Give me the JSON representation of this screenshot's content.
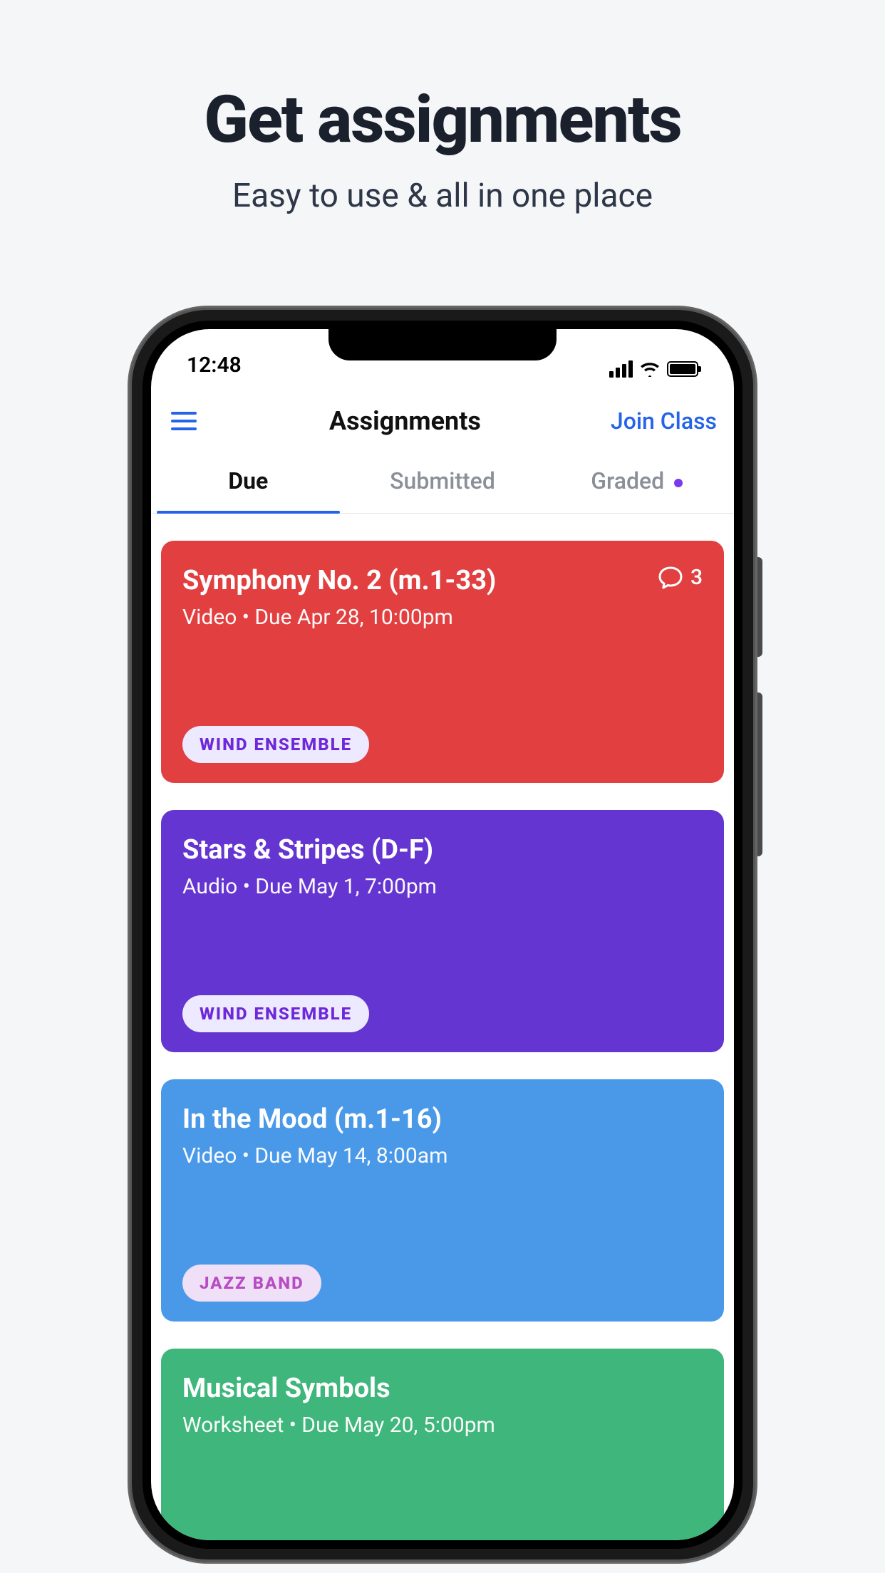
{
  "promo": {
    "title": "Get assignments",
    "subtitle": "Easy to use & all in one place"
  },
  "status": {
    "time": "12:48"
  },
  "nav": {
    "title": "Assignments",
    "join": "Join Class"
  },
  "tabs": {
    "due": "Due",
    "submitted": "Submitted",
    "graded": "Graded",
    "graded_has_dot": true,
    "active": "due"
  },
  "cards": [
    {
      "title": "Symphony No. 2 (m.1-33)",
      "sub": "Video • Due Apr 28, 10:00pm",
      "chip": "WIND ENSEMBLE",
      "comments": "3",
      "color": "red"
    },
    {
      "title": "Stars & Stripes (D-F)",
      "sub": "Audio • Due May 1, 7:00pm",
      "chip": "WIND ENSEMBLE",
      "color": "purple"
    },
    {
      "title": "In the Mood (m.1-16)",
      "sub": "Video • Due May 14, 8:00am",
      "chip": "JAZZ BAND",
      "chipStyle": "blue",
      "color": "blue"
    },
    {
      "title": "Musical Symbols",
      "sub": "Worksheet • Due May 20, 5:00pm",
      "color": "green"
    }
  ]
}
